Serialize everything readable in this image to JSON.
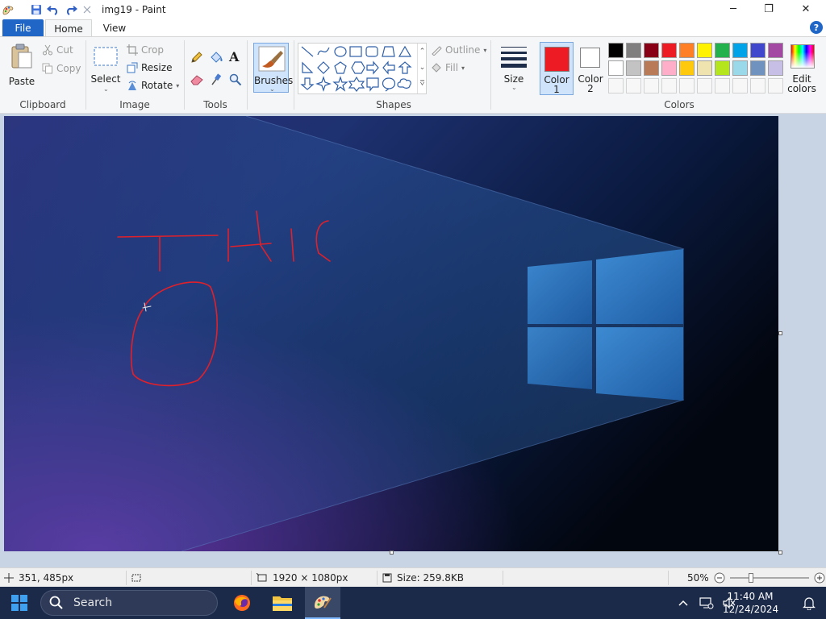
{
  "window": {
    "title": "img19 - Paint",
    "minimize": "─",
    "maximize": "❐",
    "close": "✕"
  },
  "tabs": {
    "file": "File",
    "home": "Home",
    "view": "View"
  },
  "help": "?",
  "ribbon": {
    "clipboard": {
      "paste": "Paste",
      "cut": "Cut",
      "copy": "Copy",
      "label": "Clipboard"
    },
    "image": {
      "select": "Select",
      "crop": "Crop",
      "resize": "Resize",
      "rotate": "Rotate",
      "label": "Image"
    },
    "tools": {
      "label": "Tools"
    },
    "brushes": {
      "label": "Brushes"
    },
    "shapes": {
      "outline": "Outline",
      "fill": "Fill",
      "label": "Shapes"
    },
    "size": {
      "label": "Size"
    },
    "color1": {
      "line1": "Color",
      "line2": "1",
      "value": "#ed1c24"
    },
    "color2": {
      "line1": "Color",
      "line2": "2",
      "value": "#ffffff"
    },
    "colors": {
      "label": "Colors",
      "edit_line1": "Edit",
      "edit_line2": "colors",
      "row1": [
        "#000000",
        "#7f7f7f",
        "#880015",
        "#ed1c24",
        "#ff7f27",
        "#fff200",
        "#22b14c",
        "#00a2e8",
        "#3f48cc",
        "#a349a4"
      ],
      "row2": [
        "#ffffff",
        "#c3c3c3",
        "#b97a57",
        "#ffaec9",
        "#ffc90e",
        "#efe4b0",
        "#b5e61d",
        "#99d9ea",
        "#7092be",
        "#c8bfe7"
      ]
    }
  },
  "status": {
    "cursor_pos": "351, 485px",
    "image_size": "1920 × 1080px",
    "file_size": "Size: 259.8KB",
    "zoom": "50%",
    "zoom_level": 0.5
  },
  "taskbar": {
    "search": "Search",
    "time": "11:40 AM",
    "date": "12/24/2024"
  }
}
